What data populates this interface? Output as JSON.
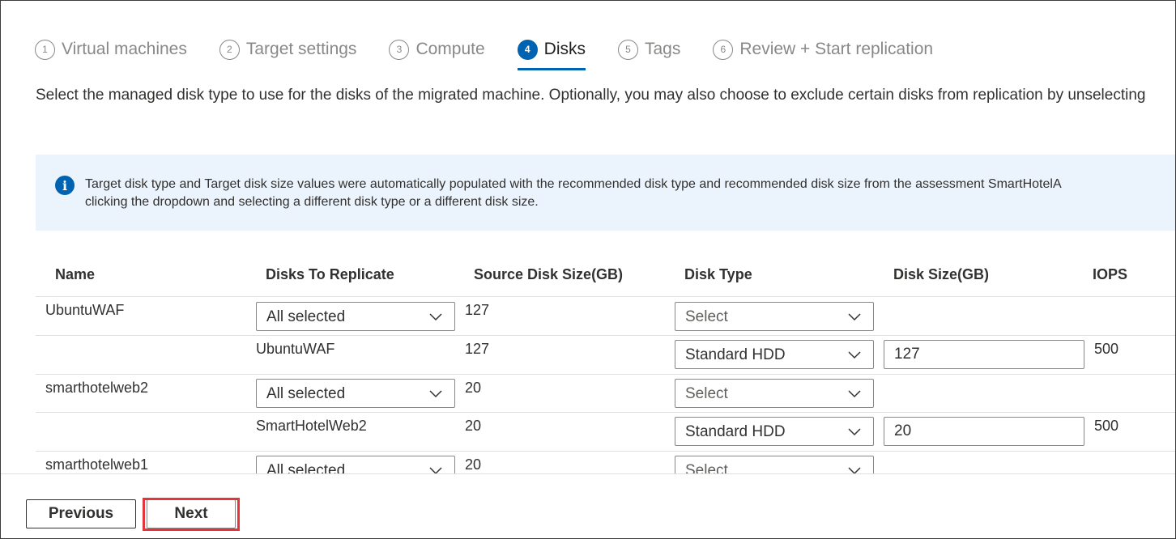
{
  "steps": [
    {
      "number": "1",
      "label": "Virtual machines"
    },
    {
      "number": "2",
      "label": "Target settings"
    },
    {
      "number": "3",
      "label": "Compute"
    },
    {
      "number": "4",
      "label": "Disks"
    },
    {
      "number": "5",
      "label": "Tags"
    },
    {
      "number": "6",
      "label": "Review + Start replication"
    }
  ],
  "active_step": "Disks",
  "description": "Select the managed disk type to use for the disks of the migrated machine. Optionally, you may also choose to exclude certain disks from replication by unselecting",
  "info": {
    "icon": "info-icon",
    "line1": "Target disk type and Target disk size values were automatically populated with the recommended disk type and recommended disk size from the assessment SmartHotelA",
    "line2": "clicking the dropdown and selecting a different disk type or a different disk size."
  },
  "table": {
    "headers": {
      "name": "Name",
      "disks_to_replicate": "Disks To Replicate",
      "source_disk_size": "Source Disk Size(GB)",
      "disk_type": "Disk Type",
      "disk_size": "Disk Size(GB)",
      "iops": "IOPS"
    },
    "rows": [
      {
        "name": "UbuntuWAF",
        "disks": "All selected",
        "source_size": "127",
        "disk_type": "Select"
      },
      {
        "disk_name": "UbuntuWAF",
        "source_size": "127",
        "disk_type": "Standard HDD",
        "disk_size": "127",
        "iops": "500"
      },
      {
        "name": "smarthotelweb2",
        "disks": "All selected",
        "source_size": "20",
        "disk_type": "Select"
      },
      {
        "disk_name": "SmartHotelWeb2",
        "source_size": "20",
        "disk_type": "Standard HDD",
        "disk_size": "20",
        "iops": "500"
      },
      {
        "name": "smarthotelweb1",
        "disks": "All selected",
        "source_size": "20",
        "disk_type": "Select"
      }
    ]
  },
  "footer": {
    "previous_label": "Previous",
    "next_label": "Next",
    "highlight_color": "#e3353a"
  },
  "colors": {
    "accent": "#0063b1",
    "info_background": "#ebf3fc"
  }
}
